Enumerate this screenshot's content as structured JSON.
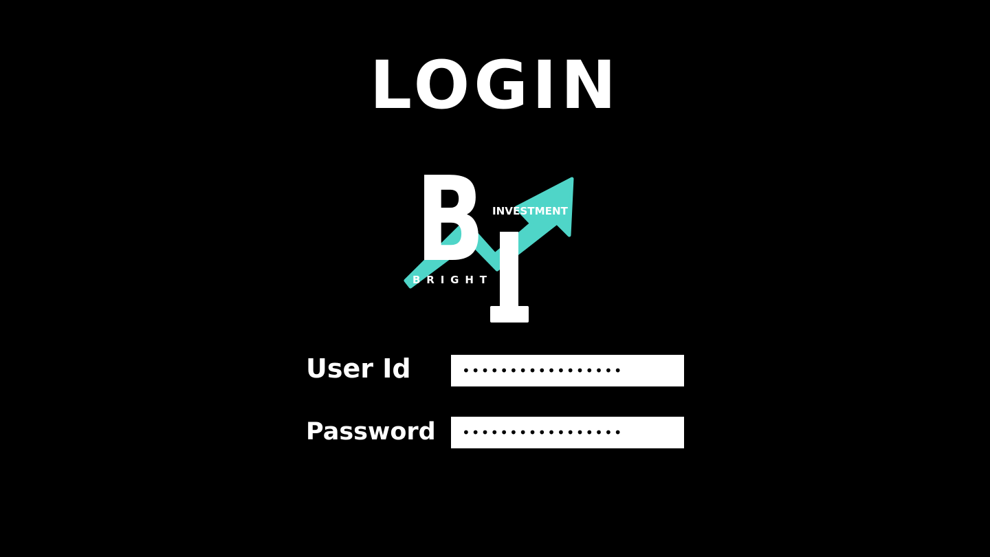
{
  "page": {
    "title": "LOGIN",
    "background_color": "#000000"
  },
  "logo": {
    "letter_b": "B",
    "letter_i": "I",
    "word_top": "INVESTMENT",
    "word_bottom": "BRIGHT",
    "arrow_color": "#4fd5c8",
    "letter_color": "#ffffff"
  },
  "form": {
    "user_id": {
      "label": "User Id",
      "value": "•••••••••••••••••"
    },
    "password": {
      "label": "Password",
      "value": "•••••••••••••••••"
    }
  }
}
